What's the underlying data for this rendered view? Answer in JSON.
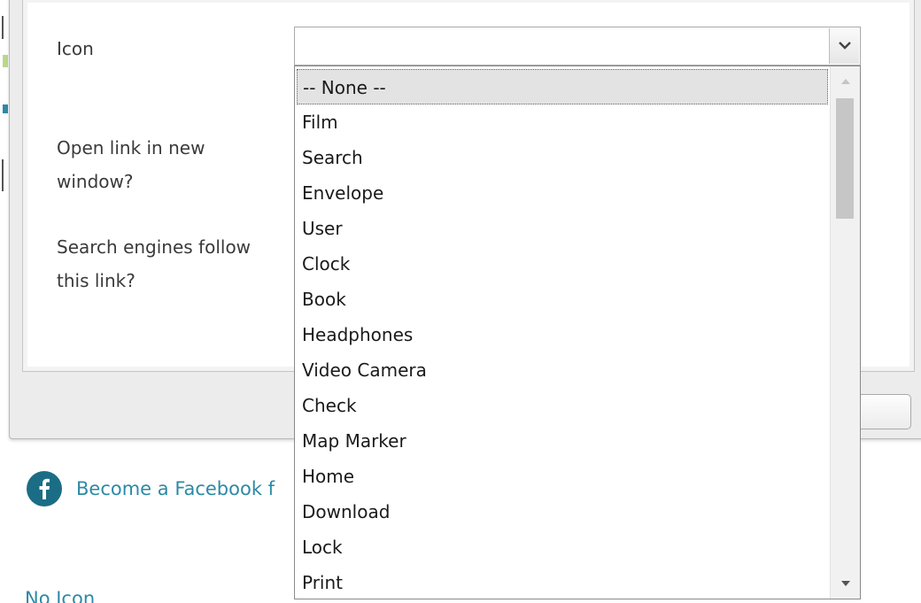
{
  "form": {
    "icon_label": "Icon",
    "open_new_window_label": "Open link in new window?",
    "search_engines_label": "Search engines follow this link?",
    "icon_select_value": ""
  },
  "dropdown": {
    "items": [
      "-- None --",
      "Film",
      "Search",
      "Envelope",
      "User",
      "Clock",
      "Book",
      "Headphones",
      "Video Camera",
      "Check",
      "Map Marker",
      "Home",
      "Download",
      "Lock",
      "Print"
    ],
    "selected_index": 0
  },
  "page": {
    "facebook_link_text": "Become a Facebook f",
    "no_icon_text": "No Icon"
  },
  "icons": {
    "select_arrow": "chevron-down-icon",
    "scroll_up": "scroll-up-icon",
    "scroll_down": "scroll-down-icon",
    "facebook": "facebook-icon"
  },
  "colors": {
    "link": "#2c8aa4",
    "facebook_badge": "#1b6d85",
    "selected_item_bg": "#e3e3e3"
  }
}
